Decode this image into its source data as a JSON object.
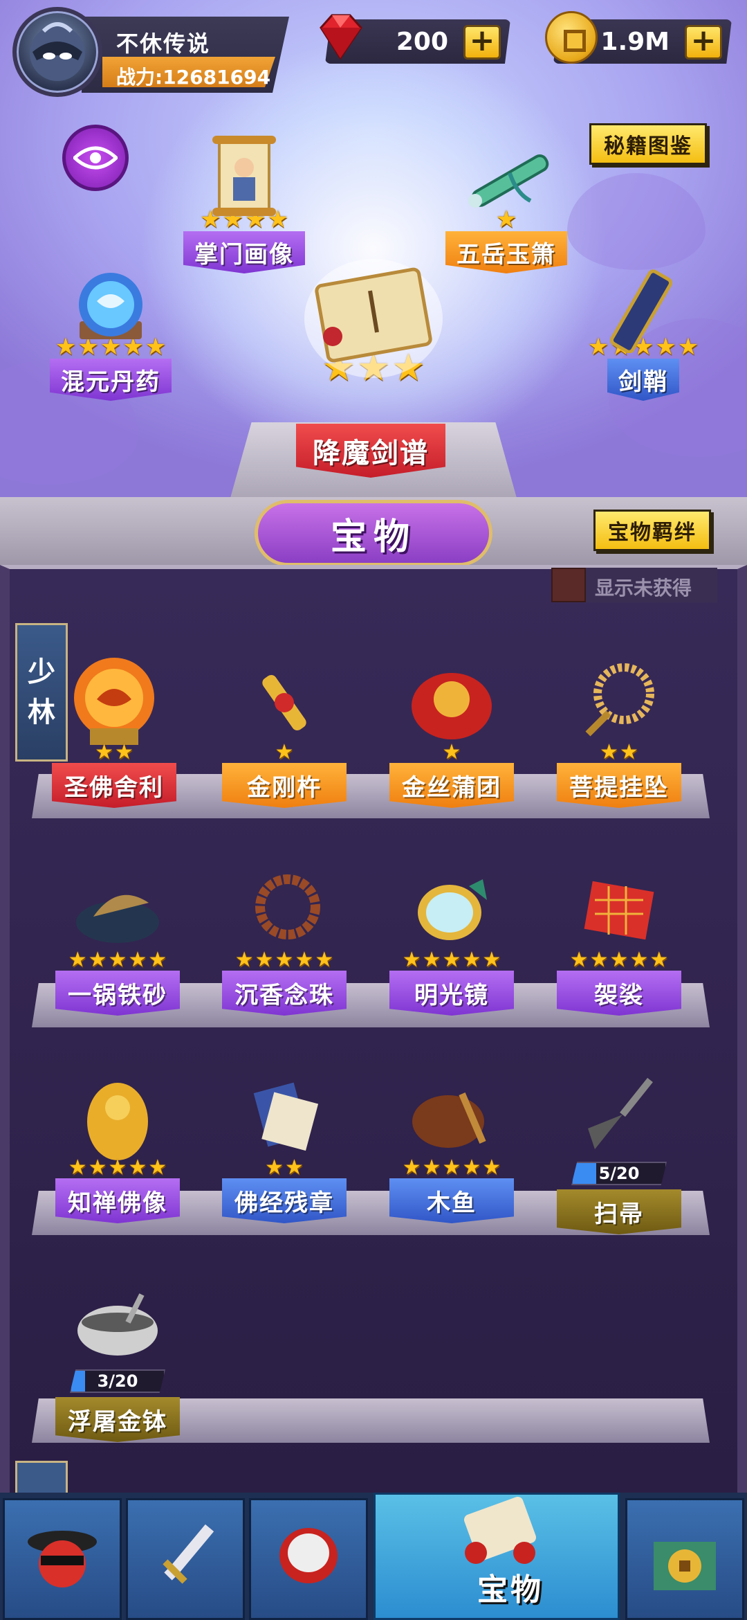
{
  "player": {
    "name": "不休传说",
    "power": "战力:12681694"
  },
  "currency": {
    "gems": "200",
    "coins": "1.9M",
    "plus": "+"
  },
  "buttons": {
    "codex": "秘籍图鉴",
    "bond": "宝物羁绊"
  },
  "display_slots": [
    {
      "name": "掌门画像",
      "stars": 4,
      "color": "purple"
    },
    {
      "name": "五岳玉箫",
      "stars": 1,
      "color": "orange"
    },
    {
      "name": "混元丹药",
      "stars": 5,
      "color": "purple"
    },
    {
      "name": "降魔剑谱",
      "stars": 3,
      "color": "red"
    },
    {
      "name": "剑鞘",
      "stars": 5,
      "color": "blue"
    }
  ],
  "section_title": "宝物",
  "toggle_label": "显示未获得",
  "sect_tag": [
    "少",
    "林"
  ],
  "items": [
    {
      "name": "圣佛舍利",
      "stars": 2,
      "color": "red"
    },
    {
      "name": "金刚杵",
      "stars": 1,
      "color": "orange"
    },
    {
      "name": "金丝蒲团",
      "stars": 1,
      "color": "orange"
    },
    {
      "name": "菩提挂坠",
      "stars": 2,
      "color": "orange"
    },
    {
      "name": "一锅铁砂",
      "stars": 5,
      "color": "purple"
    },
    {
      "name": "沉香念珠",
      "stars": 5,
      "color": "purple"
    },
    {
      "name": "明光镜",
      "stars": 5,
      "color": "purple"
    },
    {
      "name": "袈裟",
      "stars": 5,
      "color": "purple"
    },
    {
      "name": "知禅佛像",
      "stars": 5,
      "color": "purple"
    },
    {
      "name": "佛经残章",
      "stars": 2,
      "color": "blue"
    },
    {
      "name": "木鱼",
      "stars": 5,
      "color": "blue"
    },
    {
      "name": "扫帚",
      "progress": "5/20",
      "progress_value": 0.25,
      "color": "olive"
    },
    {
      "name": "浮屠金钵",
      "progress": "3/20",
      "progress_value": 0.15,
      "color": "olive"
    }
  ],
  "nav": {
    "active_label": "宝物"
  }
}
